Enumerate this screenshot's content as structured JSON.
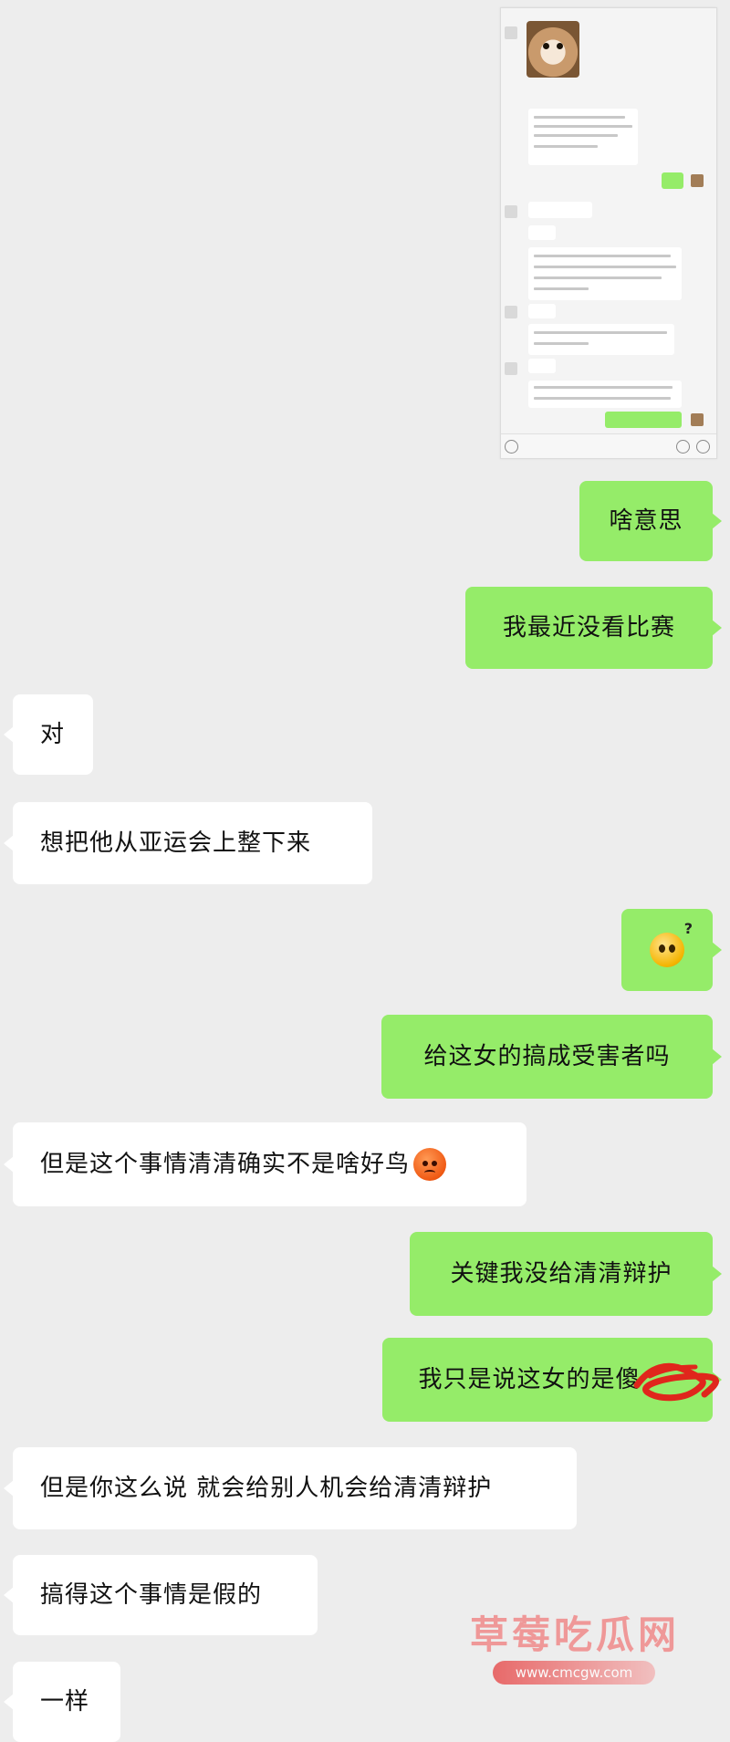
{
  "messages": [
    {
      "side": "right",
      "text": "啥意思"
    },
    {
      "side": "right",
      "text": "我最近没看比赛"
    },
    {
      "side": "left",
      "text": "对"
    },
    {
      "side": "left",
      "text": "想把他从亚运会上整下来"
    },
    {
      "side": "right",
      "emoji": "confused-question-emoji"
    },
    {
      "side": "right",
      "text": "给这女的搞成受害者吗"
    },
    {
      "side": "left",
      "text": "但是这个事情清清确实不是啥好鸟",
      "emoji": "angry-emoji"
    },
    {
      "side": "right",
      "text": "关键我没给清清辩护"
    },
    {
      "side": "right",
      "text": "我只是说这女的是傻",
      "overlay": "red-scribble"
    },
    {
      "side": "left",
      "text": "但是你这么说 就会给别人机会给清清辩护"
    },
    {
      "side": "left",
      "text": "搞得这个事情是假的"
    },
    {
      "side": "left",
      "text": "一样"
    }
  ],
  "watermark": {
    "title": "草莓吃瓜网",
    "url": "www.cmcgw.com"
  },
  "colors": {
    "sent_bubble": "#95ec69",
    "received_bubble": "#ffffff",
    "background": "#ededed",
    "watermark": "#f08484"
  }
}
